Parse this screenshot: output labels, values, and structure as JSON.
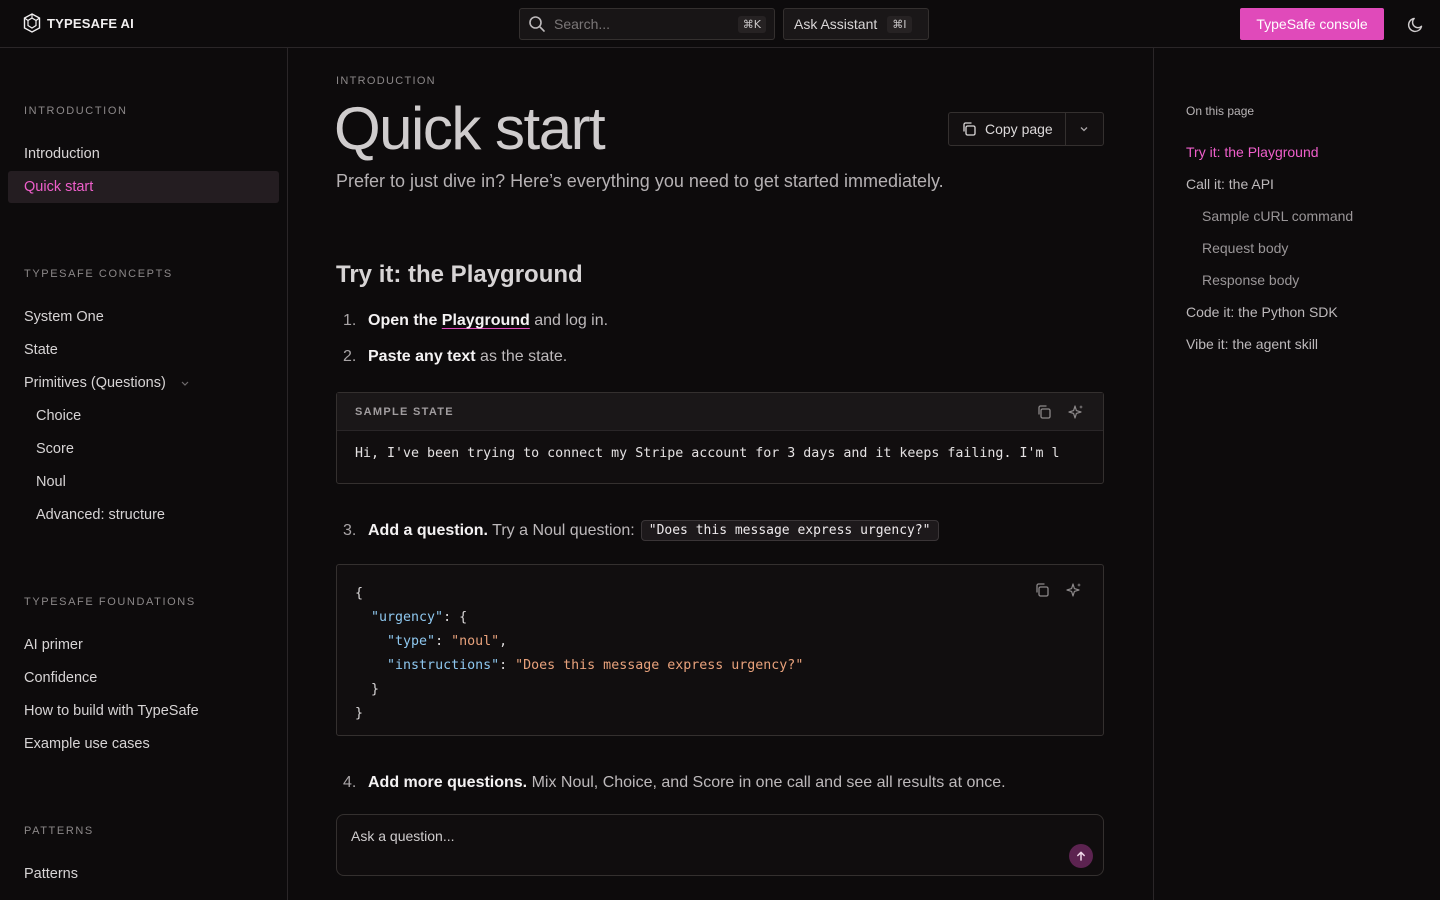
{
  "header": {
    "brand": "TYPESAFE AI",
    "search_placeholder": "Search...",
    "search_shortcut": "⌘K",
    "ask_label": "Ask Assistant",
    "ask_shortcut": "⌘I",
    "console_label": "TypeSafe console"
  },
  "sidebar": {
    "sections": [
      {
        "title": "INTRODUCTION",
        "items": [
          {
            "label": "Introduction"
          },
          {
            "label": "Quick start",
            "active": true
          }
        ]
      },
      {
        "title": "TYPESAFE CONCEPTS",
        "items": [
          {
            "label": "System One"
          },
          {
            "label": "State"
          },
          {
            "label": "Primitives (Questions)"
          },
          {
            "label": "Choice"
          },
          {
            "label": "Score"
          },
          {
            "label": "Noul"
          },
          {
            "label": "Advanced: structure"
          }
        ]
      },
      {
        "title": "TYPESAFE FOUNDATIONS",
        "items": [
          {
            "label": "AI primer"
          },
          {
            "label": "Confidence"
          },
          {
            "label": "How to build with TypeSafe"
          },
          {
            "label": "Example use cases"
          }
        ]
      },
      {
        "title": "PATTERNS",
        "items": [
          {
            "label": "Patterns"
          }
        ]
      }
    ]
  },
  "main": {
    "eyebrow": "INTRODUCTION",
    "title": "Quick start",
    "copy_page_label": "Copy page",
    "subtitle": "Prefer to just dive in? Here’s everything you need to get started immediately.",
    "section_heading": "Try it: the Playground",
    "steps": [
      {
        "num": "1.",
        "bold": "Open the ",
        "link": "Playground",
        "rest": " and log in."
      },
      {
        "num": "2.",
        "bold": "Paste any text",
        "rest": " as the state."
      },
      {
        "num": "3.",
        "bold": "Add a question.",
        "rest": " Try a Noul question:",
        "code": "\"Does this message express urgency?\""
      },
      {
        "num": "4.",
        "bold": "Add more questions.",
        "rest": " Mix Noul, Choice, and Score in one call and see all results at once."
      }
    ],
    "sample_state": {
      "title": "SAMPLE STATE",
      "text": "Hi, I've been trying to connect my Stripe account for 3 days and it keeps failing. I'm l"
    },
    "json_lines": {
      "l1": "{",
      "k_urgency": "\"urgency\"",
      "open": ": {",
      "k_type": "\"type\"",
      "v_type": "\"noul\"",
      "k_instr": "\"instructions\"",
      "v_instr": "\"Does this message express urgency?\"",
      "close_inner": "}",
      "close_outer": "}"
    },
    "ask_placeholder": "Ask a question..."
  },
  "toc": {
    "title": "On this page",
    "items": [
      {
        "label": "Try it: the Playground",
        "active": true
      },
      {
        "label": "Call it: the API"
      },
      {
        "label": "Sample cURL command",
        "sub": true
      },
      {
        "label": "Request body",
        "sub": true
      },
      {
        "label": "Response body",
        "sub": true
      },
      {
        "label": "Code it: the Python SDK"
      },
      {
        "label": "Vibe it: the agent skill"
      }
    ]
  },
  "colors": {
    "accent": "#e04aba",
    "accent_text": "#ef5fcb",
    "background": "#0d0b0c"
  }
}
